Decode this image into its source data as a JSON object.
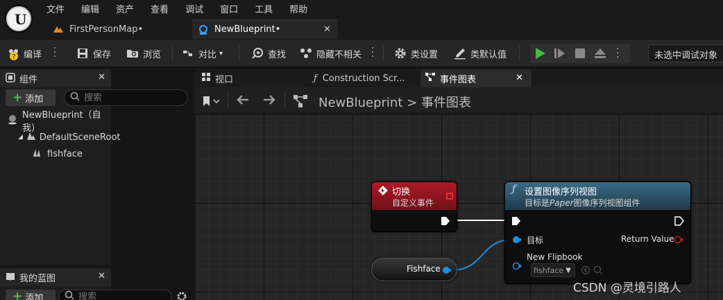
{
  "menu": [
    "文件",
    "编辑",
    "资产",
    "查看",
    "调试",
    "窗口",
    "工具",
    "帮助"
  ],
  "tabs": [
    {
      "label": "FirstPersonMap•"
    },
    {
      "label": "NewBlueprint•"
    }
  ],
  "toolbar": {
    "compile": "编译",
    "save": "保存",
    "browse": "浏览",
    "diff": "对比",
    "find": "查找",
    "hide_unrelated": "隐藏不相关",
    "class_settings": "类设置",
    "class_defaults": "类默认值",
    "debug_target": "未选中调试对象"
  },
  "components_panel": {
    "title": "组件",
    "add": "添加",
    "search_placeholder": "搜索",
    "tree": [
      "NewBlueprint（自我）",
      "DefaultSceneRoot",
      "fishface"
    ]
  },
  "my_blueprint_panel": {
    "title": "我的蓝图",
    "add": "添加",
    "search_placeholder": "搜索"
  },
  "graph_tabs": [
    {
      "label": "视口"
    },
    {
      "label": "Construction Scr..."
    },
    {
      "label": "事件图表"
    }
  ],
  "breadcrumb": {
    "root": "NewBlueprint",
    "separator": ">",
    "current": "事件图表"
  },
  "nodes": {
    "event": {
      "title": "切换",
      "subtitle": "自定义事件"
    },
    "func": {
      "title": "设置图像序列视图",
      "subtitle_prefix": "目标是",
      "subtitle_italic": "Paper",
      "subtitle_suffix": "图像序列视图组件",
      "pin_target": "目标",
      "pin_flipbook": "New Flipbook",
      "flipbook_value": "fishface",
      "return_value": "Return Value"
    },
    "var": {
      "label": "Fishface"
    }
  },
  "watermark": "CSDN @灵境引路人",
  "colors": {
    "accent_blue": "#1f8fe0",
    "event_red": "#b01826",
    "func_blue": "#3a6b86",
    "play_green": "#3fbf3f"
  }
}
